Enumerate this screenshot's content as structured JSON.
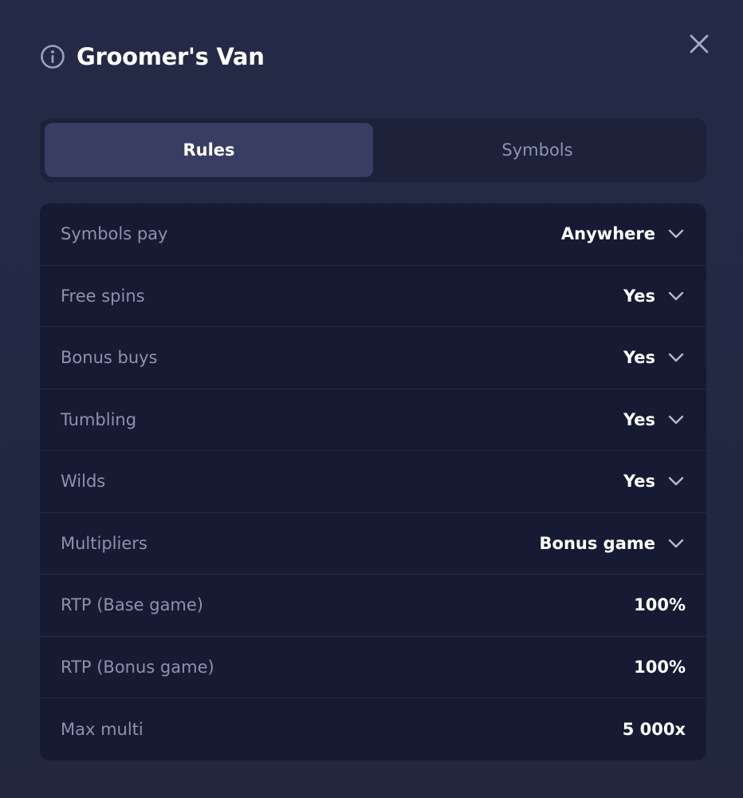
{
  "header": {
    "title": "Groomer's Van"
  },
  "tabs": [
    {
      "label": "Rules",
      "active": true
    },
    {
      "label": "Symbols",
      "active": false
    }
  ],
  "rules": [
    {
      "label": "Symbols pay",
      "value": "Anywhere",
      "expandable": true
    },
    {
      "label": "Free spins",
      "value": "Yes",
      "expandable": true
    },
    {
      "label": "Bonus buys",
      "value": "Yes",
      "expandable": true
    },
    {
      "label": "Tumbling",
      "value": "Yes",
      "expandable": true
    },
    {
      "label": "Wilds",
      "value": "Yes",
      "expandable": true
    },
    {
      "label": "Multipliers",
      "value": "Bonus game",
      "expandable": true
    },
    {
      "label": "RTP (Base game)",
      "value": "100%",
      "expandable": false
    },
    {
      "label": "RTP (Bonus game)",
      "value": "100%",
      "expandable": false
    },
    {
      "label": "Max multi",
      "value": "5 000x",
      "expandable": false
    }
  ],
  "icons": {
    "info": "info-circle-icon",
    "close": "close-icon",
    "chevron": "chevron-down-icon"
  },
  "colors": {
    "background": "#232842",
    "tab_active": "#383e63",
    "panel": "#171a33",
    "muted_text": "#8d92ad",
    "text": "#ffffff"
  }
}
